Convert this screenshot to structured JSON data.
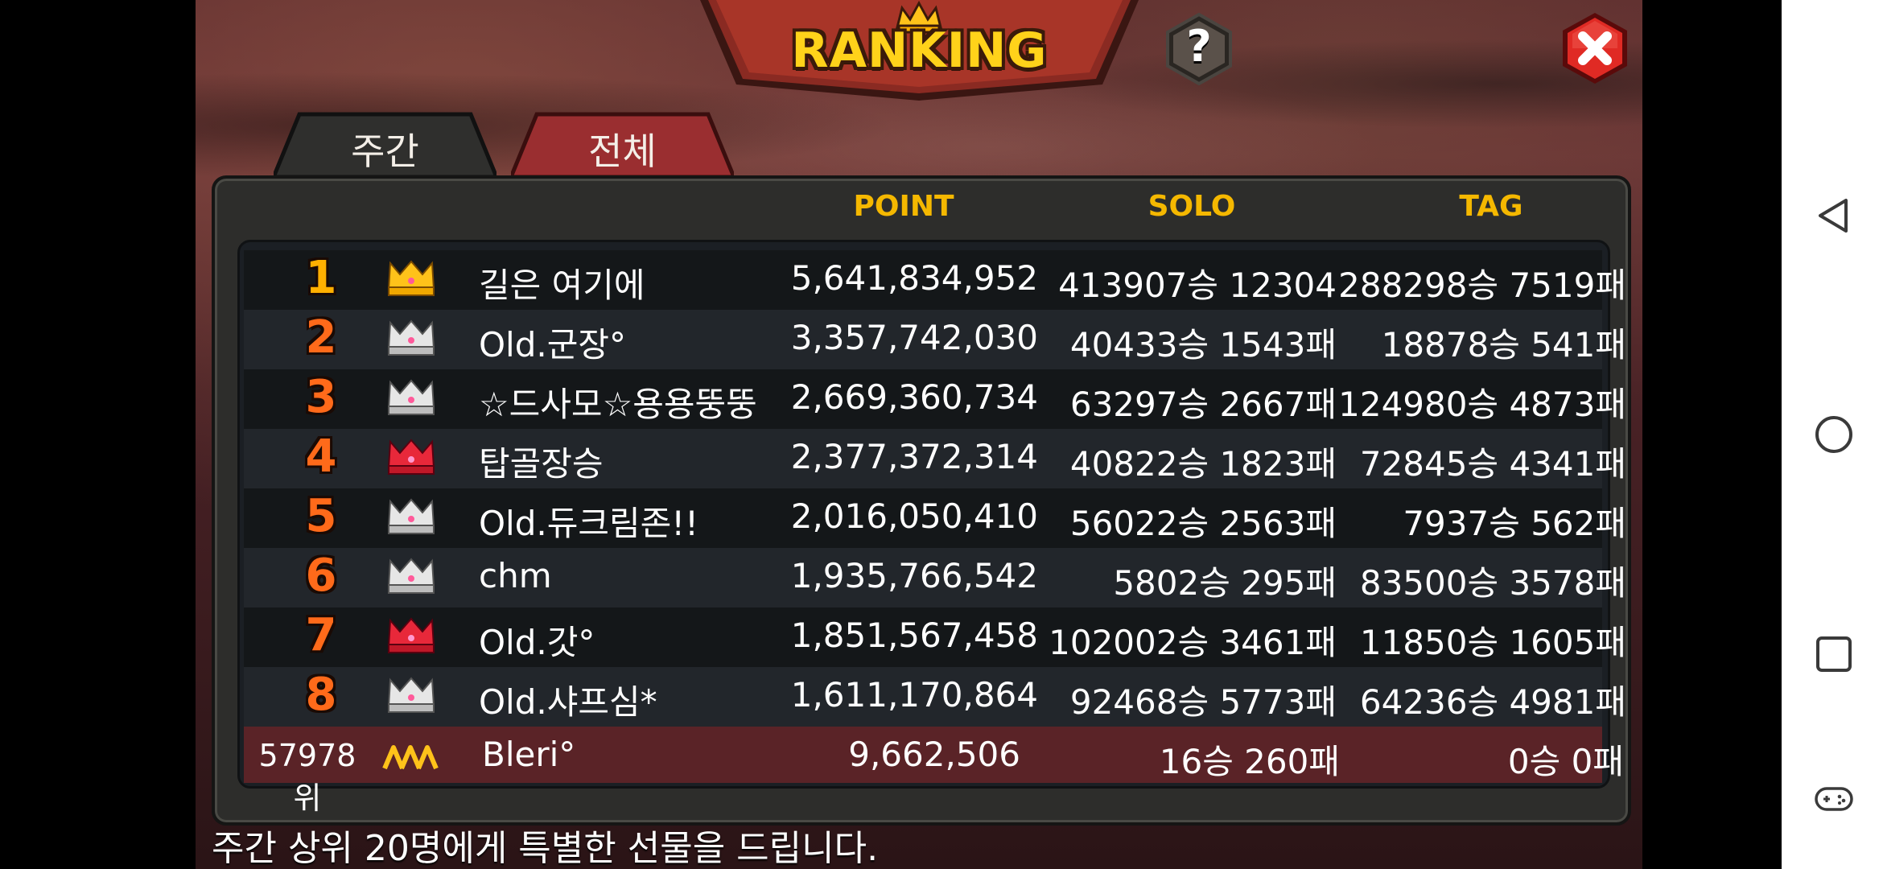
{
  "header": {
    "title": "RANKING",
    "help_label": "?",
    "close_icon": "close-icon"
  },
  "tabs": [
    {
      "label": "주간",
      "active": false
    },
    {
      "label": "전체",
      "active": true
    }
  ],
  "columns": {
    "point": "POINT",
    "solo": "SOLO",
    "tag": "TAG"
  },
  "rows": [
    {
      "rank": "1",
      "crown": "gold-crown-icon",
      "name": "길은 여기에",
      "point": "5,641,834,952",
      "solo": "413907승 12304패",
      "tag": "288298승 7519패"
    },
    {
      "rank": "2",
      "crown": "silver-crown-icon",
      "name": "Old.군장°",
      "point": "3,357,742,030",
      "solo": "40433승 1543패",
      "tag": "18878승 541패"
    },
    {
      "rank": "3",
      "crown": "silver-crown-icon",
      "name": "☆드사모☆용용뚱뚱",
      "point": "2,669,360,734",
      "solo": "63297승 2667패",
      "tag": "124980승 4873패"
    },
    {
      "rank": "4",
      "crown": "red-crown-icon",
      "name": "탑골장승",
      "point": "2,377,372,314",
      "solo": "40822승 1823패",
      "tag": "72845승 4341패"
    },
    {
      "rank": "5",
      "crown": "silver-crown-icon",
      "name": "Old.듀크림존!!",
      "point": "2,016,050,410",
      "solo": "56022승 2563패",
      "tag": "7937승 562패"
    },
    {
      "rank": "6",
      "crown": "silver-crown-icon",
      "name": "chm",
      "point": "1,935,766,542",
      "solo": "5802승 295패",
      "tag": "83500승 3578패"
    },
    {
      "rank": "7",
      "crown": "red-crown-icon",
      "name": "Old.갓°",
      "point": "1,851,567,458",
      "solo": "102002승 3461패",
      "tag": "11850승 1605패"
    },
    {
      "rank": "8",
      "crown": "silver-crown-icon",
      "name": "Old.샤프심*",
      "point": "1,611,170,864",
      "solo": "92468승 5773패",
      "tag": "64236승 4981패"
    }
  ],
  "my_row": {
    "rank": "57978위",
    "badge": "gold-rank-badge-icon",
    "name": "Bleri°",
    "point": "9,662,506",
    "solo": "16승 260패",
    "tag": "0승 0패"
  },
  "footer": {
    "note": "주간 상위 20명에게 특별한 선물을 드립니다."
  },
  "navbar": [
    "back-icon",
    "home-icon",
    "recents-icon",
    "game-controller-icon"
  ]
}
